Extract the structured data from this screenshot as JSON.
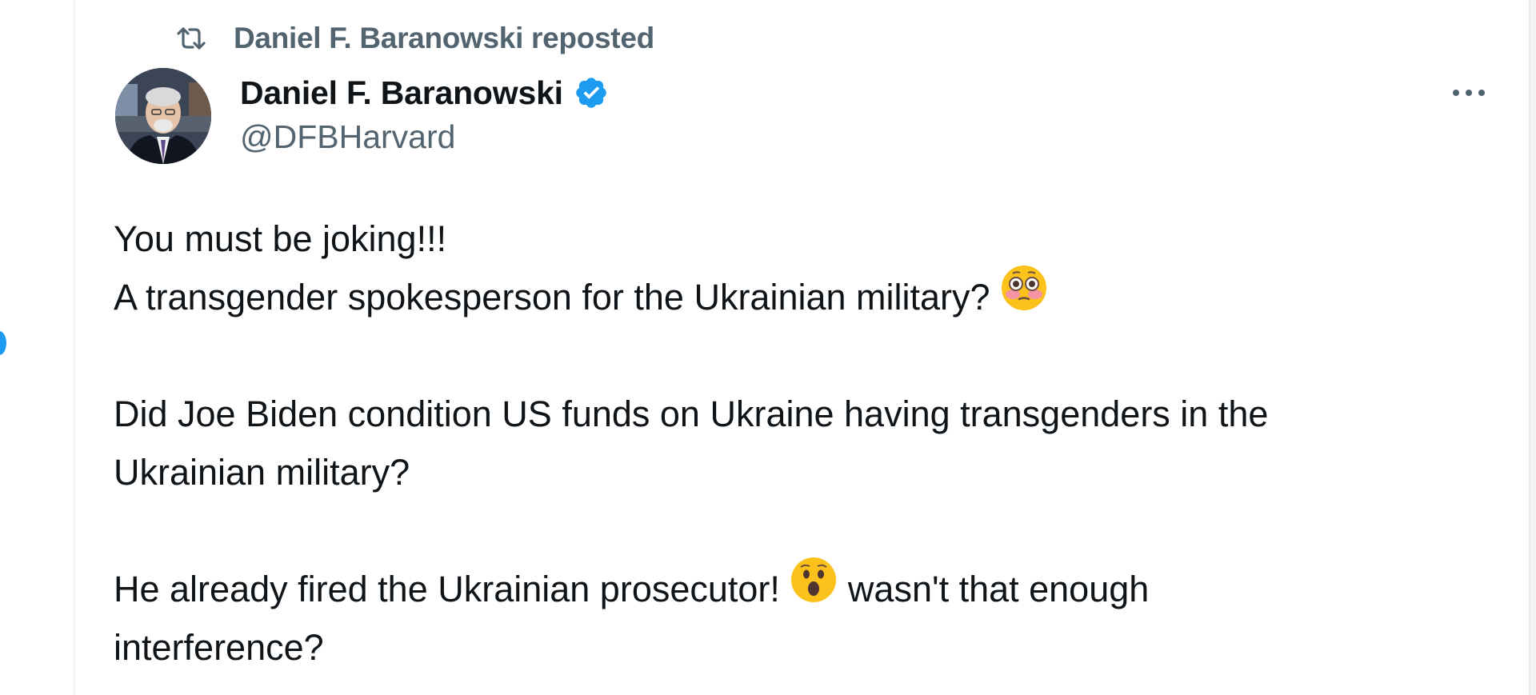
{
  "repost": {
    "icon": "repost-icon",
    "text": "Daniel F. Baranowski reposted"
  },
  "author": {
    "avatar": "avatar",
    "display_name": "Daniel F. Baranowski",
    "verified_icon": "verified-badge-icon",
    "handle": "@DFBHarvard"
  },
  "menu": {
    "icon": "more-options-icon"
  },
  "tweet": {
    "line1": "You must be joking!!!",
    "line2": "A transgender spokesperson for the Ukrainian military? ",
    "line3": "Did Joe Biden condition US funds on Ukraine having transgenders in the",
    "line4": "Ukrainian military?",
    "line5a": "He already fired the Ukrainian prosecutor! ",
    "line5b": " wasn't that enough",
    "line6": "interference?",
    "emoji1": "flushed-face-emoji",
    "emoji2": "surprised-face-emoji"
  },
  "colors": {
    "text_primary": "#0f1419",
    "text_secondary": "#536471",
    "accent": "#1d9bf0"
  }
}
